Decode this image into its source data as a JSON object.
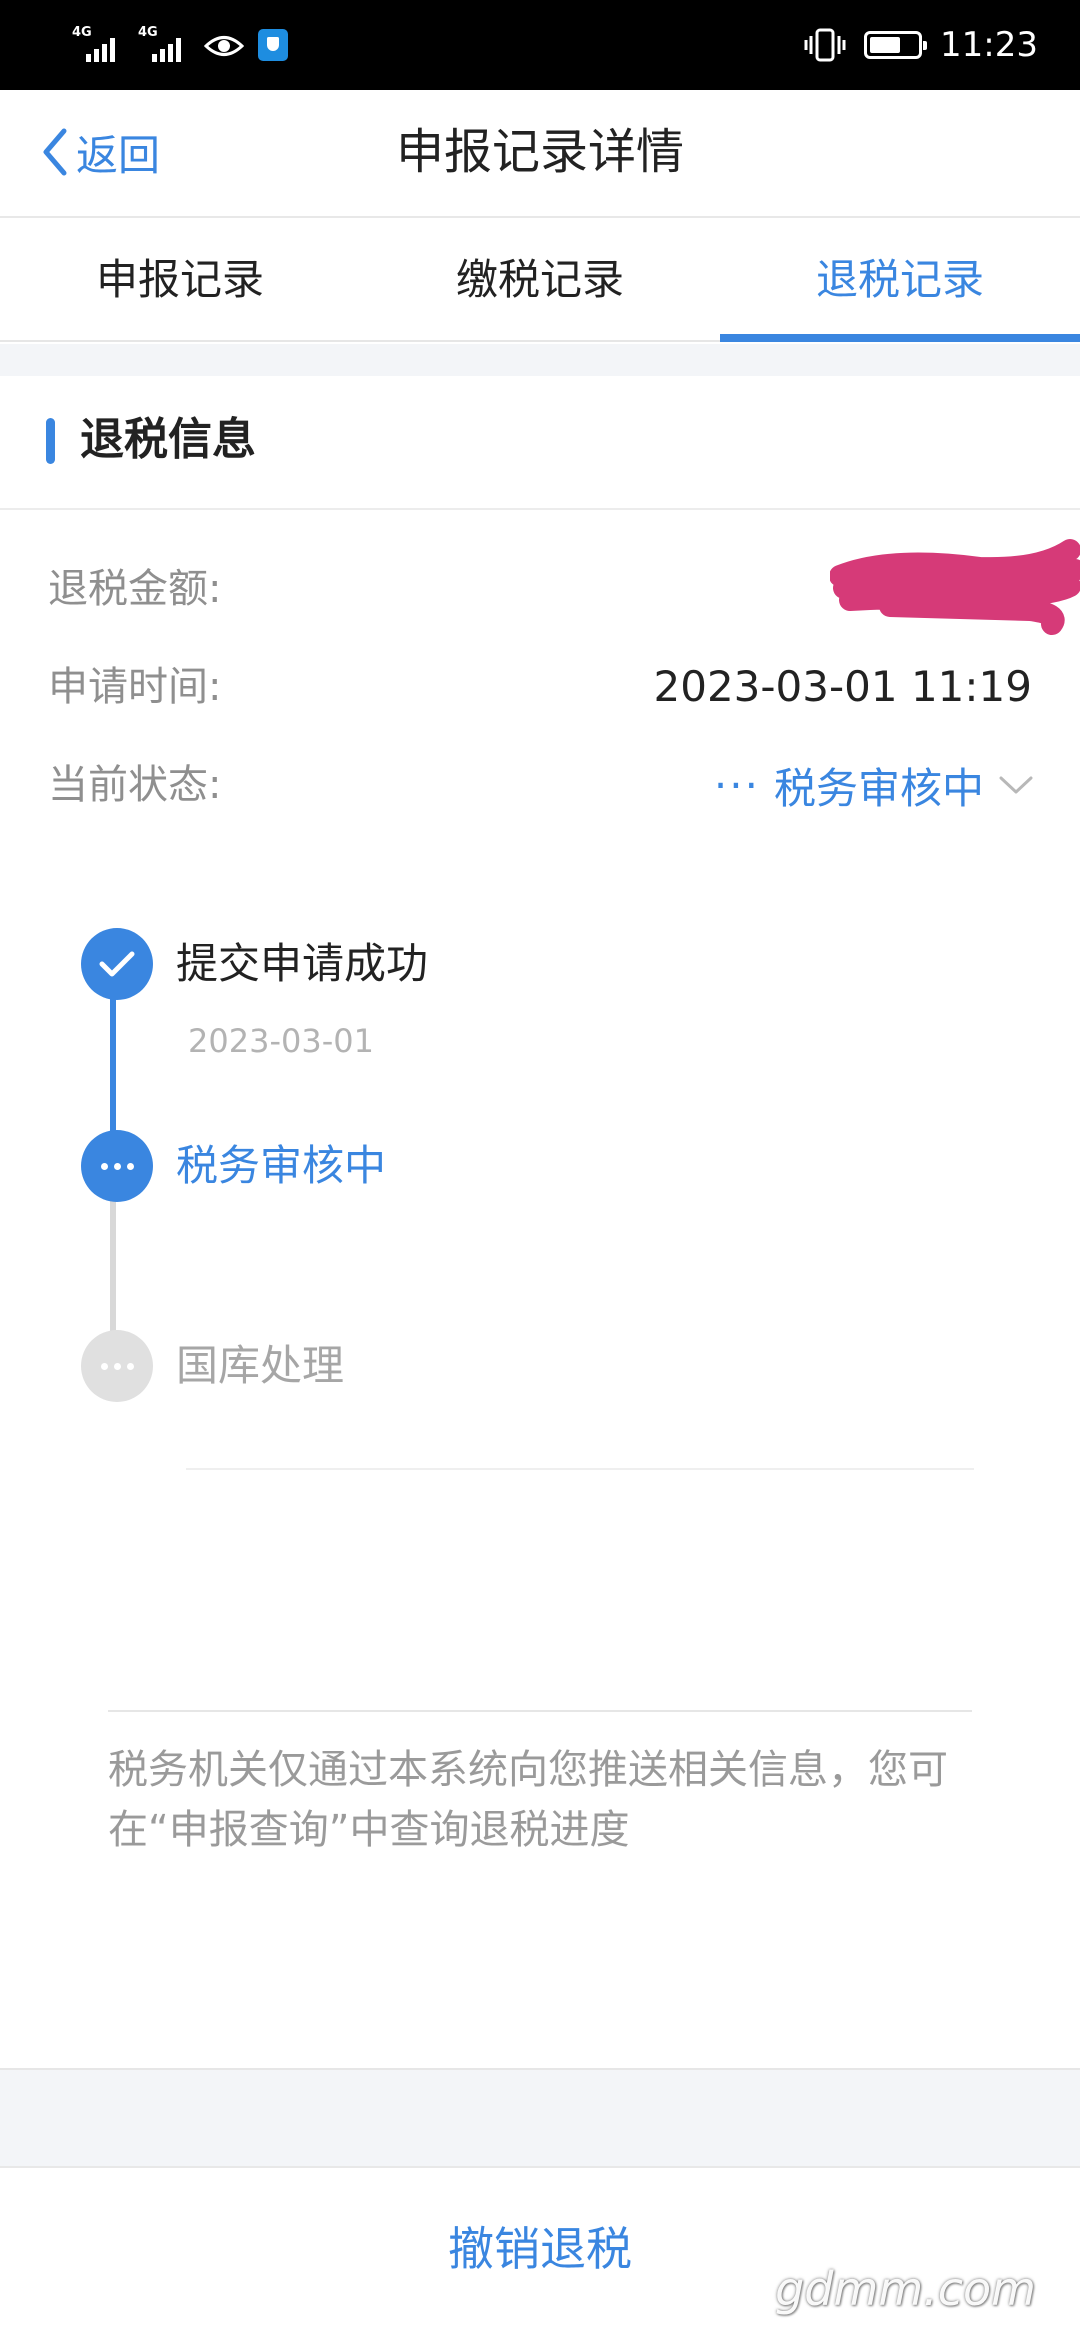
{
  "status_bar": {
    "net1": "4G",
    "net2": "4G",
    "time": "11:23"
  },
  "nav": {
    "back_label": "返回",
    "title": "申报记录详情"
  },
  "tabs": [
    {
      "label": "申报记录",
      "active": false
    },
    {
      "label": "缴税记录",
      "active": false
    },
    {
      "label": "退税记录",
      "active": true
    }
  ],
  "section": {
    "title": "退税信息"
  },
  "info": {
    "amount_label": "退税金额:",
    "amount_value": "",
    "time_label": "申请时间:",
    "time_value": "2023-03-01 11:19",
    "status_label": "当前状态:",
    "status_value": "税务审核中",
    "status_prefix": "···"
  },
  "timeline": [
    {
      "label": "提交申请成功",
      "date": "2023-03-01",
      "state": "done"
    },
    {
      "label": "税务审核中",
      "state": "current"
    },
    {
      "label": "国库处理",
      "state": "pending"
    }
  ],
  "notice": "税务机关仅通过本系统向您推送相关信息，您可在“申报查询”中查询退税进度",
  "bottom": {
    "cancel_label": "撤销退税"
  },
  "watermark": "gdmm.com",
  "colors": {
    "accent": "#3a86e0",
    "redaction": "#d63a78",
    "pending": "#e0e0e0"
  }
}
